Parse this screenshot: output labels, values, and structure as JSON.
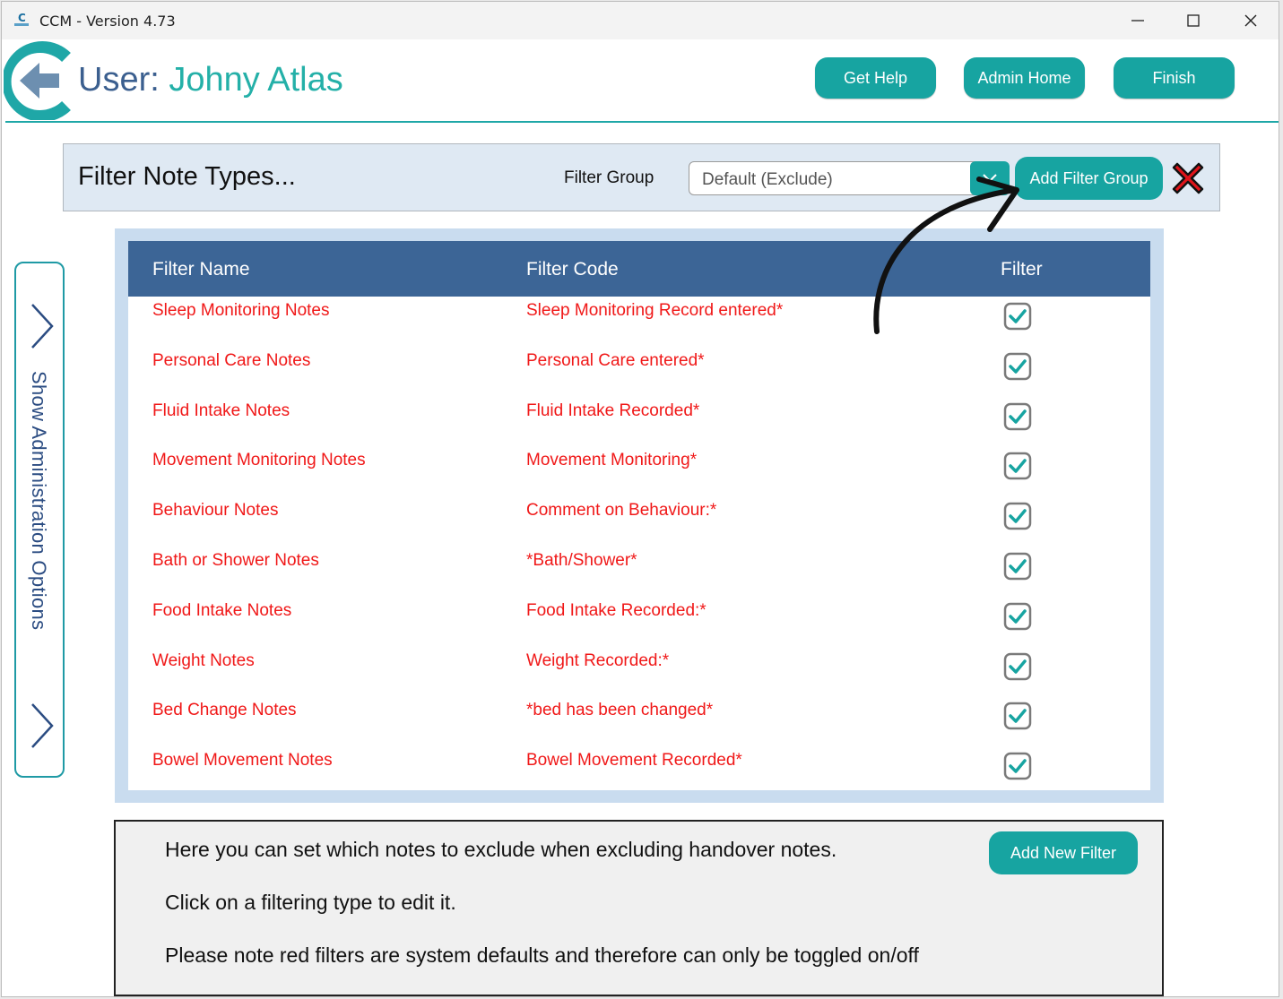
{
  "window": {
    "title": "CCM - Version 4.73"
  },
  "header": {
    "user_prefix": "User: ",
    "user_name": "Johny Atlas",
    "buttons": {
      "help": "Get Help",
      "admin_home": "Admin Home",
      "finish": "Finish"
    }
  },
  "filter_bar": {
    "title": "Filter Note Types...",
    "group_label": "Filter Group",
    "group_value": "Default (Exclude)",
    "add_group": "Add Filter Group"
  },
  "sidebar": {
    "label": "Show Administration Options"
  },
  "table": {
    "columns": [
      "Filter Name",
      "Filter Code",
      "Filter"
    ],
    "rows": [
      {
        "name": "Sleep Monitoring Notes",
        "code": "Sleep Monitoring Record entered*",
        "checked": true
      },
      {
        "name": "Personal Care Notes",
        "code": "Personal Care entered*",
        "checked": true
      },
      {
        "name": "Fluid Intake Notes",
        "code": "Fluid Intake Recorded*",
        "checked": true
      },
      {
        "name": "Movement Monitoring Notes",
        "code": "Movement Monitoring*",
        "checked": true
      },
      {
        "name": "Behaviour Notes",
        "code": "Comment on Behaviour:*",
        "checked": true
      },
      {
        "name": "Bath or Shower Notes",
        "code": "*Bath/Shower*",
        "checked": true
      },
      {
        "name": "Food Intake Notes",
        "code": "Food Intake Recorded:*",
        "checked": true
      },
      {
        "name": "Weight Notes",
        "code": "Weight Recorded:*",
        "checked": true
      },
      {
        "name": "Bed Change Notes",
        "code": "*bed has been changed*",
        "checked": true
      },
      {
        "name": "Bowel Movement Notes",
        "code": "Bowel Movement Recorded*",
        "checked": true
      }
    ]
  },
  "info": {
    "line1": "Here you can set which notes to exclude when excluding handover notes.",
    "line2": "Click on a filtering type to edit it.",
    "line3": "Please note red filters are system defaults and therefore can only be toggled on/off",
    "add_new": "Add New Filter"
  },
  "colors": {
    "accent": "#17a4a1",
    "header_bg": "#3c6596",
    "default_filter_text": "#f01818",
    "user_label": "#3b5f8f"
  },
  "icons": [
    "app-icon",
    "minimize-icon",
    "maximize-icon",
    "close-icon",
    "logo-icon",
    "chevron-down-icon",
    "delete-x-icon",
    "chevron-right-icon",
    "checkbox-checked-icon",
    "annotation-arrow"
  ]
}
